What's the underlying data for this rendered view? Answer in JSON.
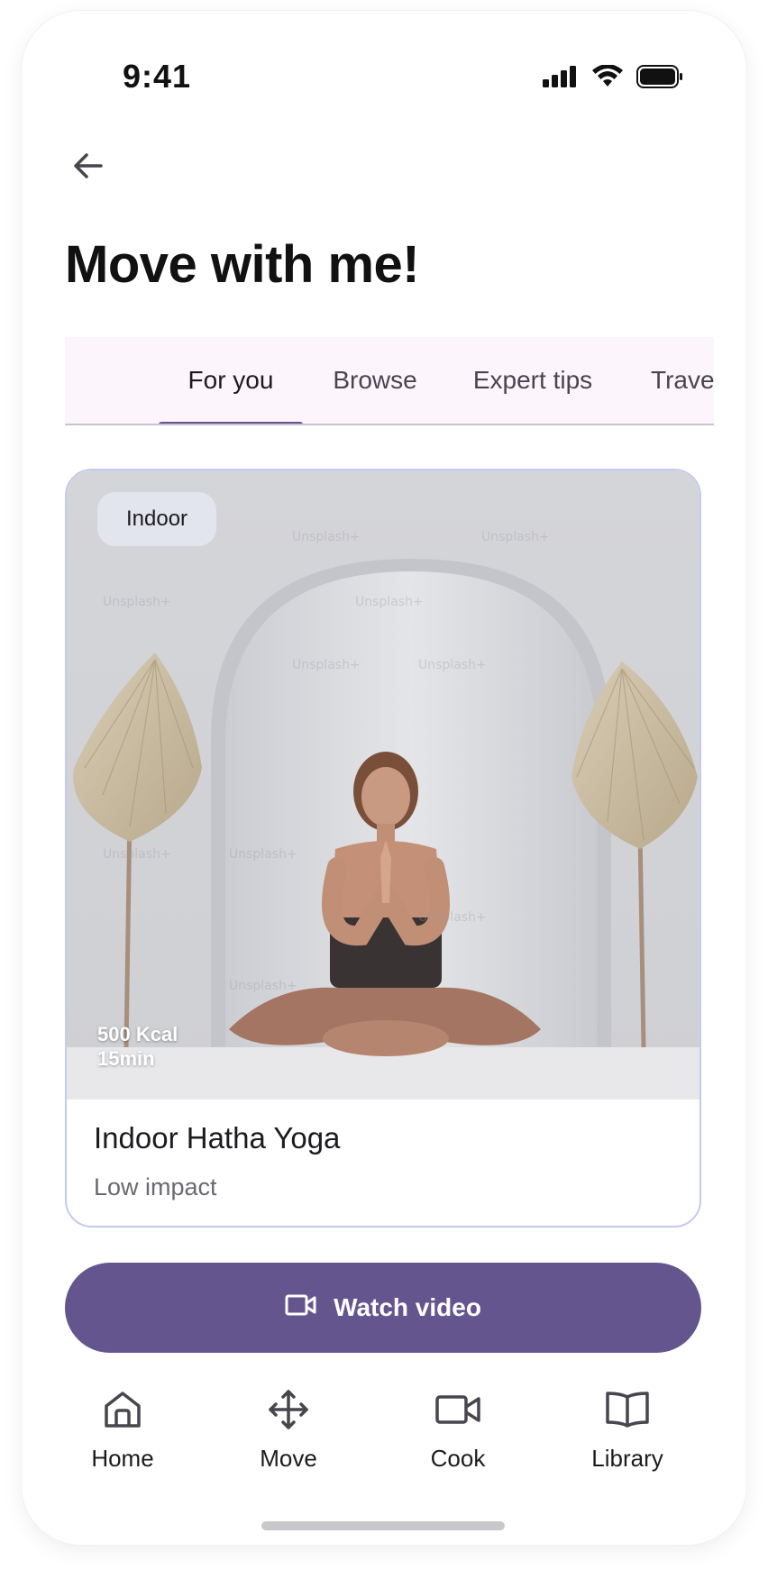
{
  "status_bar": {
    "time": "9:41",
    "icons": [
      "signal-icon",
      "wifi-icon",
      "battery-icon"
    ]
  },
  "header": {
    "back_icon": "arrow-left-icon",
    "title": "Move with me!"
  },
  "tabs": [
    {
      "label": "For you",
      "active": true
    },
    {
      "label": "Browse",
      "active": false
    },
    {
      "label": "Expert tips",
      "active": false
    },
    {
      "label": "Travel",
      "active": false
    }
  ],
  "card": {
    "chip": "Indoor",
    "stats": {
      "kcal": "500 Kcal",
      "duration": "15min"
    },
    "title": "Indoor Hatha Yoga",
    "subtitle": "Low impact",
    "watermark": "Unsplash+"
  },
  "watch_button": {
    "label": "Watch video",
    "icon": "video-camera-icon"
  },
  "bottom_nav": [
    {
      "label": "Home",
      "icon": "home-icon"
    },
    {
      "label": "Move",
      "icon": "move-arrows-icon"
    },
    {
      "label": "Cook",
      "icon": "video-camera-icon"
    },
    {
      "label": "Library",
      "icon": "book-icon"
    }
  ],
  "colors": {
    "primary": "#65558f",
    "tab_background": "#fdf5fc",
    "card_border": "#c4caef",
    "chip_background": "#e3e5ee"
  }
}
